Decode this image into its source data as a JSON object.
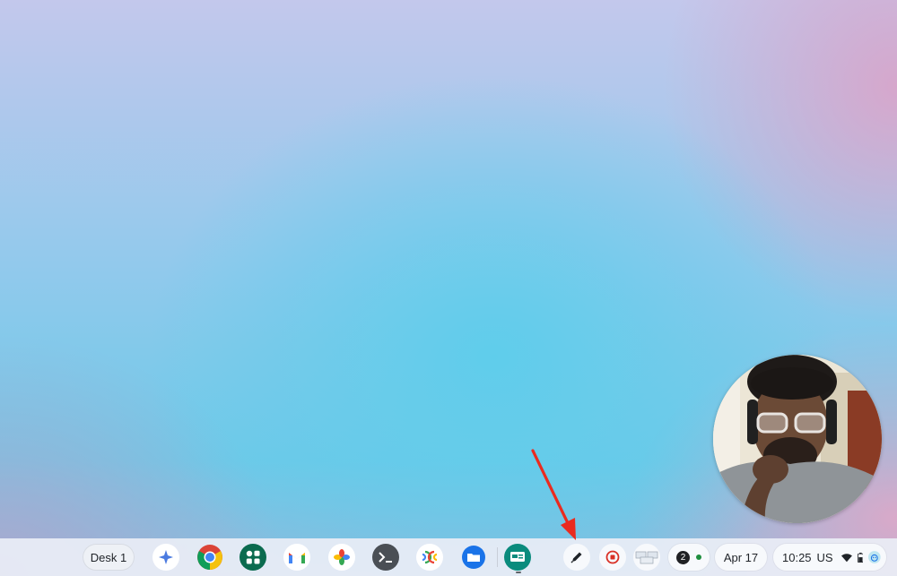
{
  "desktop": {
    "wallpaper_colors": [
      "#c3c8ec",
      "#6ec9e8",
      "#d6a7cc"
    ]
  },
  "shelf": {
    "desk_label": "Desk 1",
    "apps": [
      {
        "name": "launcher",
        "icon": "launcher-icon"
      },
      {
        "name": "chrome",
        "icon": "chrome-icon"
      },
      {
        "name": "app-grid",
        "icon": "app-grid-icon"
      },
      {
        "name": "gmail",
        "icon": "gmail-icon"
      },
      {
        "name": "photos",
        "icon": "photos-icon"
      },
      {
        "name": "terminal",
        "icon": "terminal-icon"
      },
      {
        "name": "chromecast",
        "icon": "cast-icon"
      },
      {
        "name": "files",
        "icon": "files-icon"
      },
      {
        "name": "screen-app",
        "icon": "presentation-icon"
      }
    ],
    "tools": [
      {
        "name": "annotator",
        "icon": "pen-icon"
      },
      {
        "name": "screen-record-stop",
        "icon": "stop-record-icon"
      },
      {
        "name": "holding-space",
        "icon": "thumbnails-icon"
      }
    ],
    "notification_count": "2",
    "date": "Apr 17",
    "time": "10:25",
    "input_method": "US",
    "accent_color": "#ea4335"
  }
}
